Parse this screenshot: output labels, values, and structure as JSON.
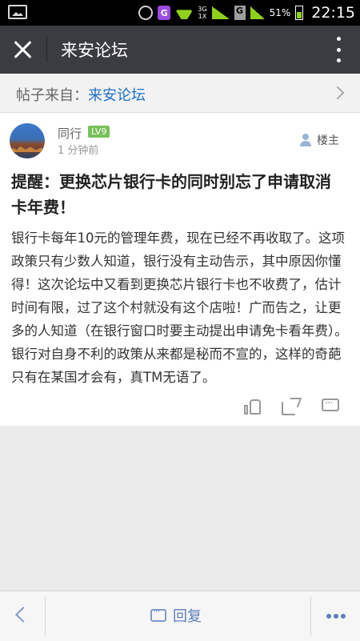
{
  "status_bar": {
    "network_top": "3G",
    "network_bottom": "1X",
    "carrier_badge": "G",
    "battery": "51%",
    "time": "22:15",
    "icons": [
      "image-icon",
      "alarm-icon",
      "g-app-icon",
      "wifi-icon",
      "signal-icon",
      "battery-icon"
    ]
  },
  "app_bar": {
    "title": "来安论坛",
    "close_icon": "close-icon",
    "more_icon": "more-vertical-icon"
  },
  "source": {
    "prefix": "帖子来自：",
    "forum": "来安论坛"
  },
  "post": {
    "author": "同行",
    "level": "LV9",
    "time": "1 分钟前",
    "owner_label": "楼主",
    "title": "提醒：更换芯片银行卡的同时别忘了申请取消卡年费！",
    "body": "银行卡每年10元的管理年费，现在已经不再收取了。这项政策只有少数人知道，银行没有主动告示，其中原因你懂得！这次论坛中又看到更换芯片银行卡也不收费了，估计时间有限，过了这个村就没有这个店啦！广而告之，让更多的人知道（在银行窗口时要主动提出申请免卡看年费）。银行对自身不利的政策从来都是秘而不宣的，这样的奇葩只有在某国才会有，真TM无语了。"
  },
  "bottom_bar": {
    "reply_label": "回复"
  },
  "colors": {
    "app_bar": "#3a3c41",
    "accent_blue": "#1f6fc5",
    "level_badge": "#78c05a",
    "page_bg": "#ebebeb"
  }
}
